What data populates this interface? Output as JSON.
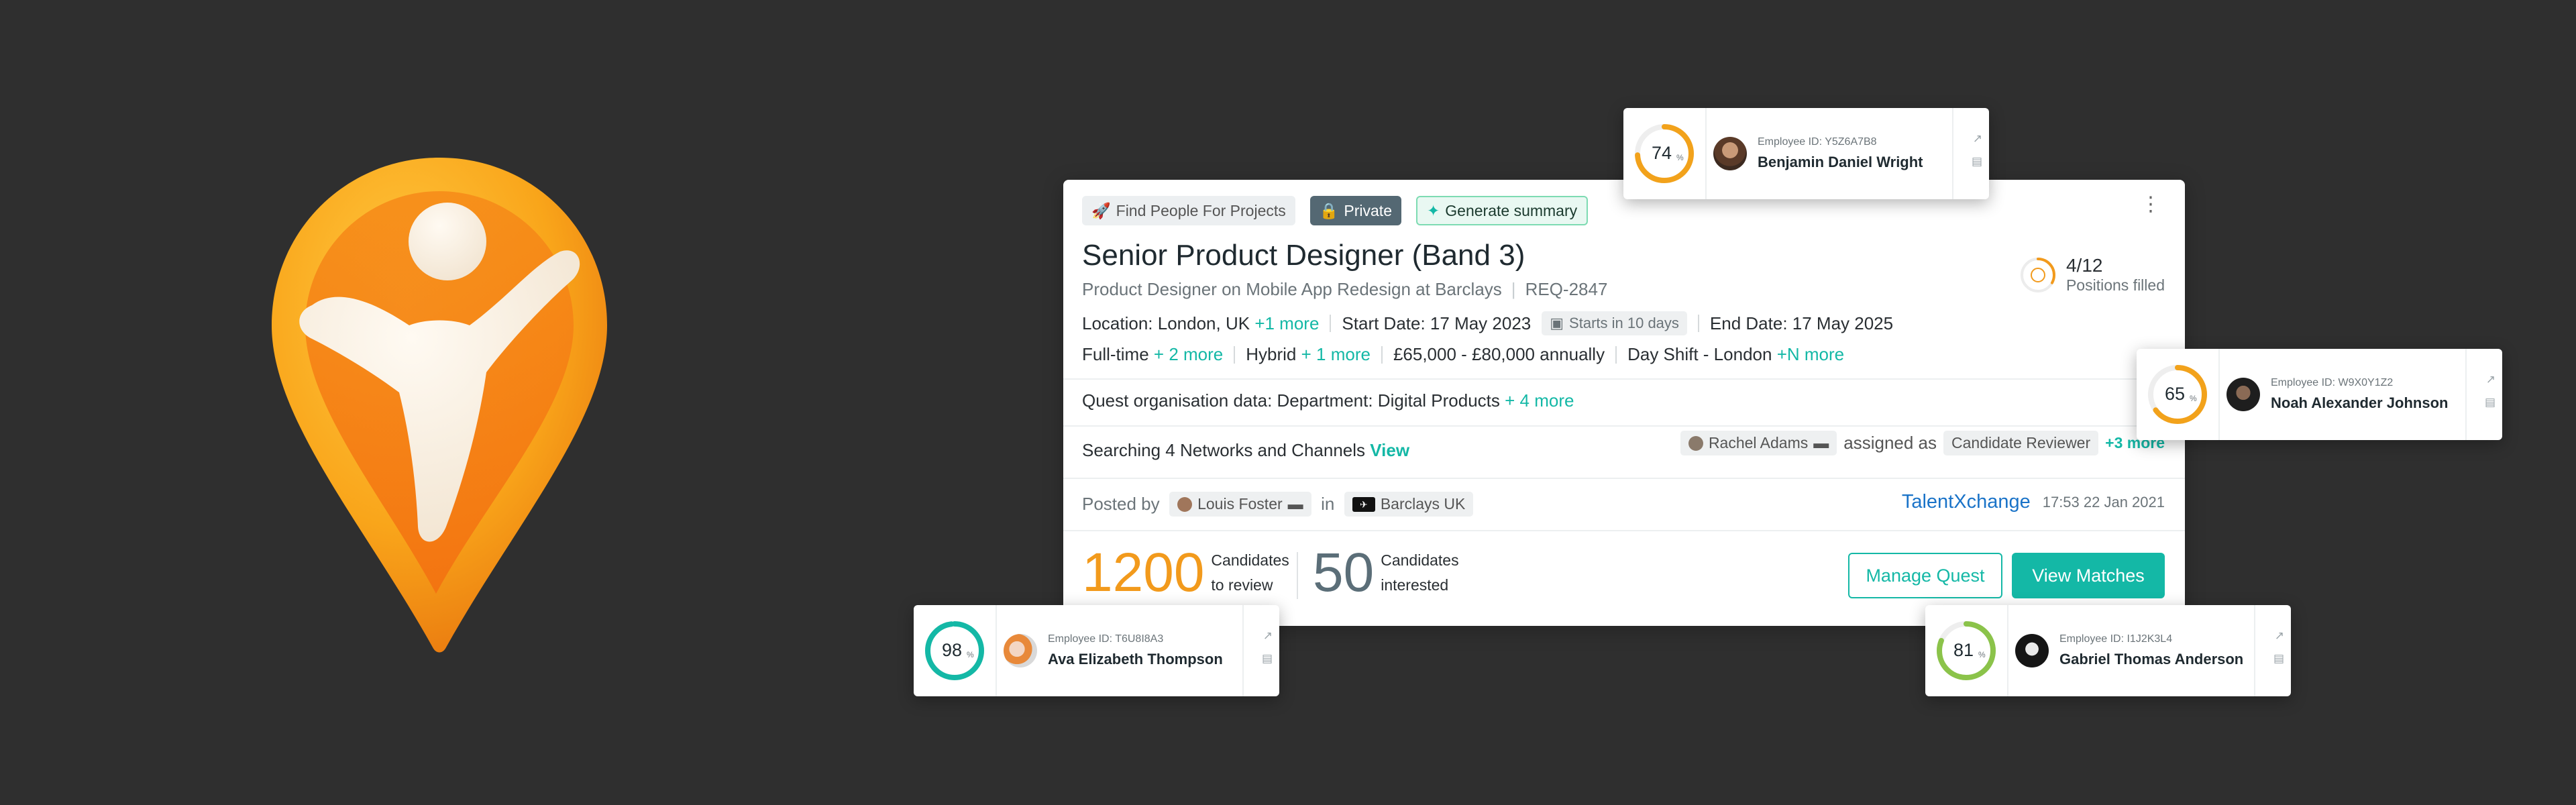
{
  "colors": {
    "background": "#2f2f2f",
    "accent_teal": "#14b8a6",
    "orange": "#f29a1c",
    "slate": "#5b6e78",
    "link_blue": "#1a73c8"
  },
  "quest": {
    "chips": {
      "find": "Find People For Projects",
      "private": "Private",
      "generate": "Generate summary"
    },
    "title": "Senior Product Designer (Band 3)",
    "subtitle": "Product Designer on Mobile App Redesign at Barclays",
    "req_id": "REQ-2847",
    "positions": {
      "value": "4/12",
      "label": "Positions filled",
      "fraction": 0.33
    },
    "location": "Location: London, UK",
    "location_more": "+1 more",
    "start_date": "Start Date: 17 May 2023",
    "starts_in": "Starts in 10 days",
    "end_date": "End Date: 17 May 2025",
    "employment": "Full-time",
    "employment_more": "+ 2 more",
    "work_mode": "Hybrid",
    "work_mode_more": "+ 1 more",
    "salary": "£65,000 - £80,000 annually",
    "shift": "Day Shift - London",
    "shift_more": "+N more",
    "org_data": "Quest organisation data: Department: Digital Products",
    "org_more": "+ 4 more",
    "searching": "Searching 4 Networks and Channels",
    "searching_view": "View",
    "assignee": "Rachel Adams",
    "assigned_as": "assigned as",
    "role": "Candidate Reviewer",
    "role_more": "+3 more",
    "posted_by_label": "Posted by",
    "posted_by": "Louis Foster",
    "in_label": "in",
    "company": "Barclays UK",
    "source": "TalentXchange",
    "timestamp": "17:53 22 Jan 2021",
    "review_count": "1200",
    "review_label_1": "Candidates",
    "review_label_2": "to review",
    "interested_count": "50",
    "interested_label_1": "Candidates",
    "interested_label_2": "interested",
    "manage_button": "Manage Quest",
    "view_button": "View Matches"
  },
  "candidates": [
    {
      "score": "74",
      "score_fraction": 0.74,
      "score_color": "#f2a21b",
      "unit": "%",
      "employee_id": "Employee ID: Y5Z6A7B8",
      "name": "Benjamin Daniel Wright"
    },
    {
      "score": "65",
      "score_fraction": 0.65,
      "score_color": "#f2a21b",
      "unit": "%",
      "employee_id": "Employee ID: W9X0Y1Z2",
      "name": "Noah Alexander Johnson"
    },
    {
      "score": "98",
      "score_fraction": 0.98,
      "score_color": "#14b8a6",
      "unit": "%",
      "employee_id": "Employee ID: T6U8I8A3",
      "name": "Ava Elizabeth Thompson"
    },
    {
      "score": "81",
      "score_fraction": 0.81,
      "score_color": "#8bc34a",
      "unit": "%",
      "employee_id": "Employee ID: I1J2K3L4",
      "name": "Gabriel Thomas Anderson"
    }
  ]
}
